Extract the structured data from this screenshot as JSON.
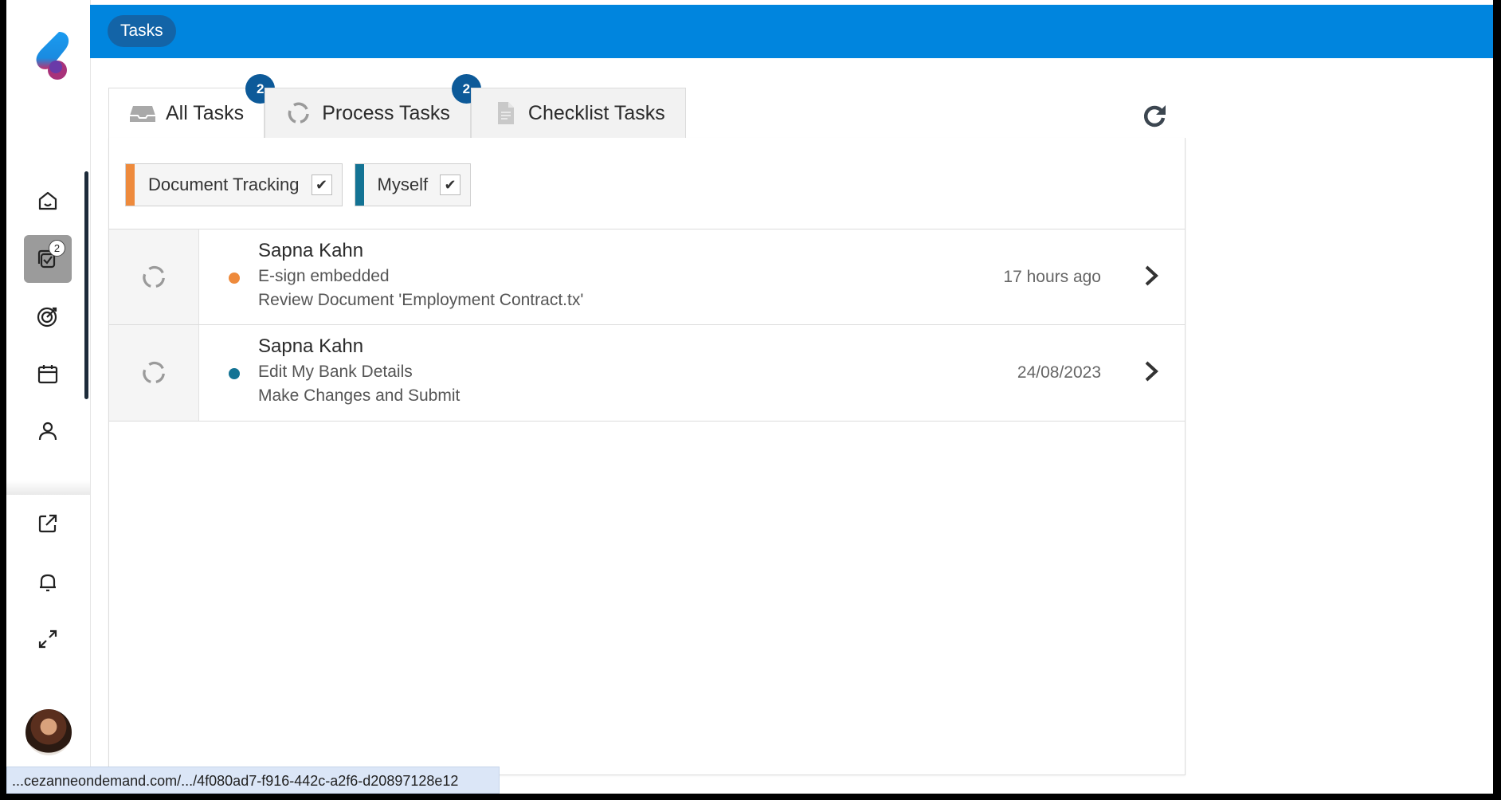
{
  "topbar": {
    "title": "Tasks"
  },
  "sidebar": {
    "items": [
      {
        "icon": "home-icon"
      },
      {
        "icon": "tasks-icon",
        "badge": "2",
        "active": true
      },
      {
        "icon": "target-icon"
      },
      {
        "icon": "calendar-icon"
      },
      {
        "icon": "person-icon"
      },
      {
        "icon": "external-link-icon"
      },
      {
        "icon": "bell-icon"
      },
      {
        "icon": "expand-icon"
      }
    ]
  },
  "tabs": [
    {
      "label": "All Tasks",
      "count": "2",
      "active": true,
      "icon": "inbox-icon"
    },
    {
      "label": "Process Tasks",
      "count": "2",
      "icon": "process-icon"
    },
    {
      "label": "Checklist Tasks",
      "icon": "document-icon"
    }
  ],
  "filters": [
    {
      "label": "Document Tracking",
      "checked": true,
      "color": "#ee8a3c"
    },
    {
      "label": "Myself",
      "checked": true,
      "color": "#137394"
    }
  ],
  "tasks": [
    {
      "name": "Sapna Kahn",
      "type": "E-sign embedded",
      "description": "Review Document 'Employment Contract.tx'",
      "time": "17 hours ago",
      "dot_color": "#ee8a3c"
    },
    {
      "name": "Sapna Kahn",
      "type": "Edit My Bank Details",
      "description": "Make Changes and Submit",
      "time": "24/08/2023",
      "dot_color": "#137394"
    }
  ],
  "status_url": "...cezanneondemand.com/.../4f080ad7-f916-442c-a2f6-d20897128e12",
  "colors": {
    "topbar": "#0085de",
    "badge": "#0d5a99",
    "accent_orange": "#ee8a3c",
    "accent_teal": "#137394"
  }
}
